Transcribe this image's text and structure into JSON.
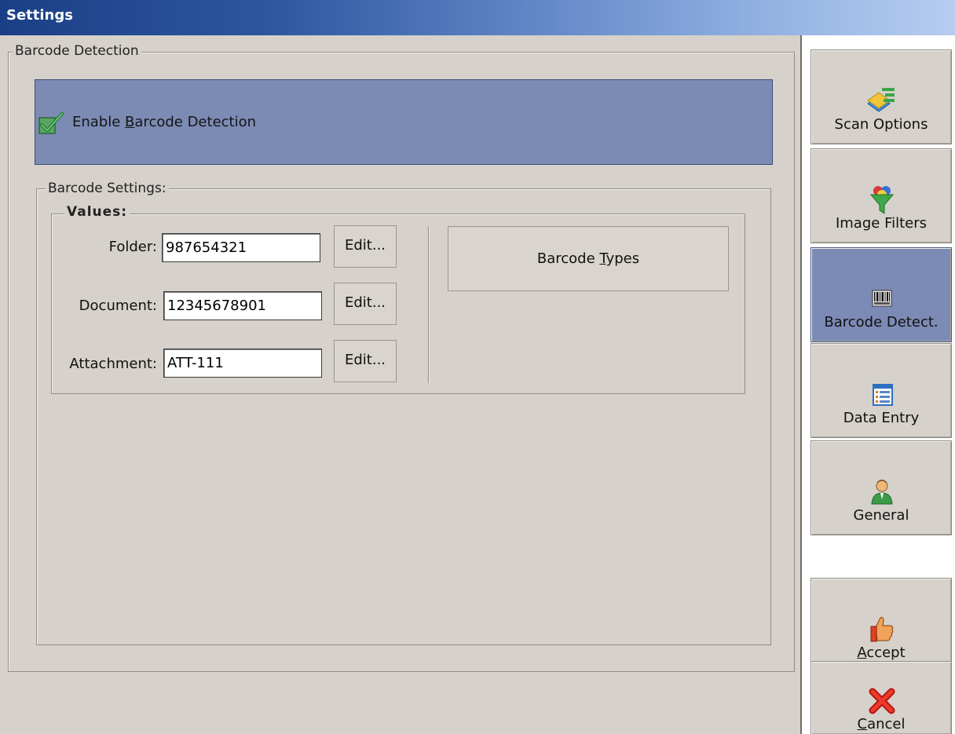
{
  "window": {
    "title": "Settings"
  },
  "barcode_detection": {
    "group_label": "Barcode Detection",
    "enable": {
      "label_before": "Enable ",
      "label_underlined": "B",
      "label_after": "arcode Detection",
      "checked": true
    },
    "settings": {
      "group_label": "Barcode Settings:",
      "values": {
        "group_label": "Values:",
        "fields": [
          {
            "label": "Folder:",
            "value": "987654321",
            "button": "Edit..."
          },
          {
            "label": "Document:",
            "value": "12345678901",
            "button": "Edit..."
          },
          {
            "label": "Attachment:",
            "value": "ATT-111",
            "button": "Edit..."
          }
        ]
      },
      "types_button": {
        "before": "Barcode ",
        "underlined": "T",
        "after": "ypes"
      }
    }
  },
  "sidebar": {
    "items": [
      {
        "label": "Scan Options",
        "icon": "scan-options-icon",
        "active": false
      },
      {
        "label": "Image Filters",
        "icon": "funnel-icon",
        "active": false
      },
      {
        "label": "Barcode Detect.",
        "icon": "barcode-icon",
        "active": true
      },
      {
        "label": "Data Entry",
        "icon": "form-list-icon",
        "active": false
      },
      {
        "label": "General",
        "icon": "user-icon",
        "active": false
      }
    ],
    "accept": {
      "underlined": "A",
      "after": "ccept",
      "icon": "thumbs-up-icon"
    },
    "cancel": {
      "underlined": "C",
      "after": "ancel",
      "icon": "red-x-icon"
    }
  },
  "colors": {
    "face": "#d6d1ca",
    "panel_blue": "#7b8bb4",
    "title_start": "#1b3f86",
    "title_end": "#b7cdf0"
  }
}
